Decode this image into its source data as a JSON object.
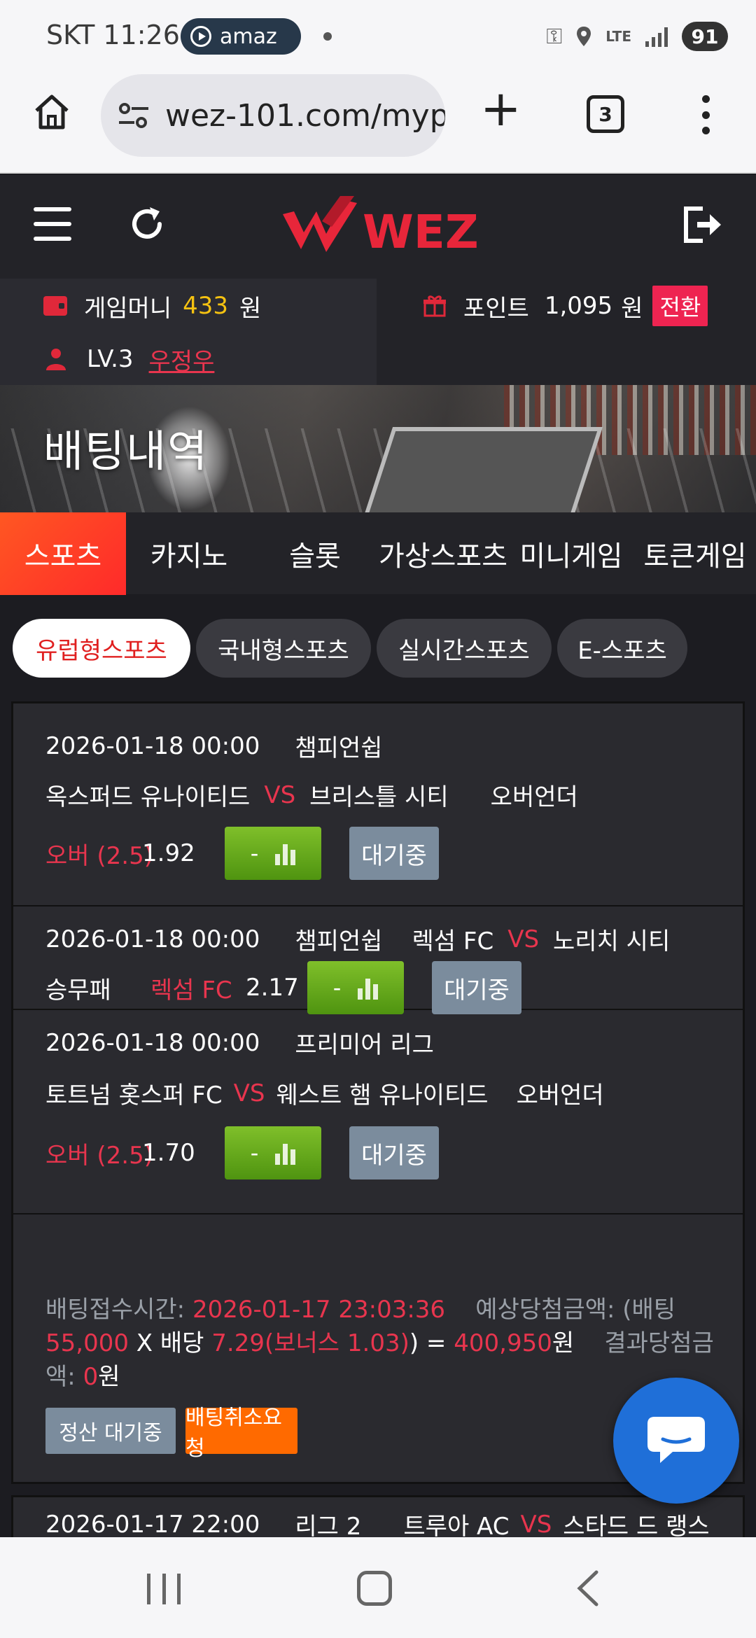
{
  "status_bar": {
    "carrier_time": "SKT 11:26",
    "media_pill": "amaz",
    "network": "LTE",
    "battery": "91"
  },
  "browser": {
    "url": "wez-101.com/myp",
    "tab_count": "3"
  },
  "site": {
    "logo_text": "WEZ",
    "brand_color": "#e8263a"
  },
  "user": {
    "money_label": "게임머니",
    "money_value": "433",
    "money_unit": "원",
    "point_label": "포인트",
    "point_value": "1,095",
    "point_unit": "원",
    "convert_label": "전환",
    "level": "LV.3",
    "username": "우정우"
  },
  "banner": {
    "title": "배팅내역"
  },
  "category_tabs": [
    {
      "label": "스포츠",
      "active": true
    },
    {
      "label": "카지노",
      "active": false
    },
    {
      "label": "슬롯",
      "active": false
    },
    {
      "label": "가상스포츠",
      "active": false
    },
    {
      "label": "미니게임",
      "active": false
    },
    {
      "label": "토큰게임",
      "active": false
    }
  ],
  "sub_tabs": [
    {
      "label": "유럽형스포츠",
      "active": true
    },
    {
      "label": "국내형스포츠",
      "active": false
    },
    {
      "label": "실시간스포츠",
      "active": false
    },
    {
      "label": "E-스포츠",
      "active": false
    }
  ],
  "bets": [
    {
      "datetime": "2026-01-18 00:00",
      "league": "챔피언쉽",
      "home": "옥스퍼드 유나이티드",
      "vs": "VS",
      "away": "브리스틀 시티",
      "market": "오버언더",
      "pick": "오버 (2.5)",
      "odds": "1.92",
      "button": "-",
      "status": "대기중"
    },
    {
      "datetime": "2026-01-18 00:00",
      "league": "챔피언쉽",
      "home": "렉섬 FC",
      "vs": "VS",
      "away": "노리치 시티",
      "market": "승무패",
      "pick": "렉섬 FC",
      "odds": "2.17",
      "button": "-",
      "status": "대기중"
    },
    {
      "datetime": "2026-01-18 00:00",
      "league": "프리미어 리그",
      "home": "토트넘 홋스퍼 FC",
      "vs": "VS",
      "away": "웨스트 햄 유나이티드",
      "market": "오버언더",
      "pick": "오버 (2.5)",
      "odds": "1.70",
      "button": "-",
      "status": "대기중"
    }
  ],
  "summary": {
    "accept_label": "배팅접수시간:",
    "accept_time": "2026-01-17 23:03:36",
    "expected_label": "예상당첨금액: (배팅",
    "stake": "55,000",
    "x": "X 배당",
    "total_odds": "7.29(보너스 1.03)",
    "close_eq": ") =",
    "expected_win": "400,950",
    "won": "원",
    "result_label": "결과당첨금액:",
    "result_value": "0",
    "result_unit": "원",
    "settle_button": "정산 대기중",
    "cancel_button": "배팅취소요청"
  },
  "next_bet": {
    "datetime": "2026-01-17 22:00",
    "league": "리그 2",
    "home": "트루아 AC",
    "vs": "VS",
    "away": "스타드 드 랭스"
  }
}
